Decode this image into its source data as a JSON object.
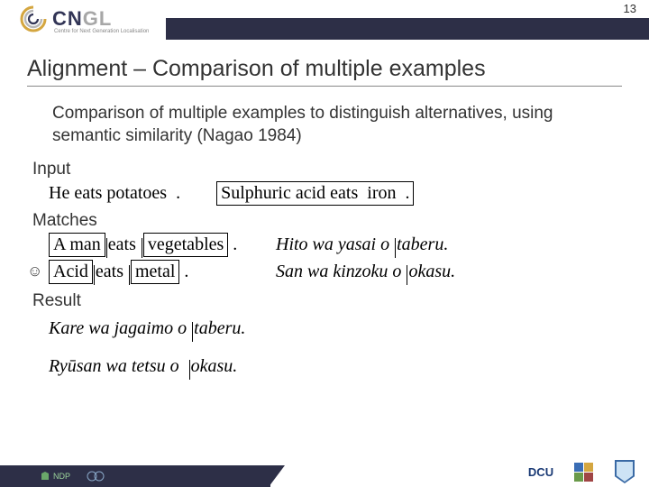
{
  "header": {
    "page_number": "13",
    "logo_main": "CNGL",
    "logo_sub": "Centre for Next Generation Localisation"
  },
  "title": "Alignment – Comparison of multiple examples",
  "description": "Comparison of multiple examples to distinguish alternatives, using semantic similarity (Nagao 1984)",
  "labels": {
    "input": "Input",
    "matches": "Matches",
    "result": "Result"
  },
  "input": {
    "ex1": {
      "subj": "He",
      "verb": "eats",
      "obj": "potatoes",
      "tail": "."
    },
    "ex2": {
      "subj": "Sulphuric acid",
      "verb": "eats",
      "obj": "iron",
      "tail": "."
    }
  },
  "matches": [
    {
      "boxed_subj": "A man",
      "mid": "eats",
      "boxed_obj": "vegetables",
      "tail": ".",
      "jp_pre": "Hito wa yasai o",
      "jp_verb": "taberu.",
      "smiley": false
    },
    {
      "boxed_subj": "Acid",
      "mid": "eats",
      "boxed_obj": "metal",
      "tail": ".",
      "jp_pre": "San wa kinzoku o",
      "jp_verb": "okasu.",
      "smiley": true
    }
  ],
  "results": [
    {
      "pre": "Kare wa jagaimo o",
      "verb": "taberu."
    },
    {
      "pre": "Ryūsan wa tetsu o",
      "verb": "okasu."
    }
  ],
  "footer": {
    "ndp": "NDP",
    "dcu": "DCU"
  }
}
